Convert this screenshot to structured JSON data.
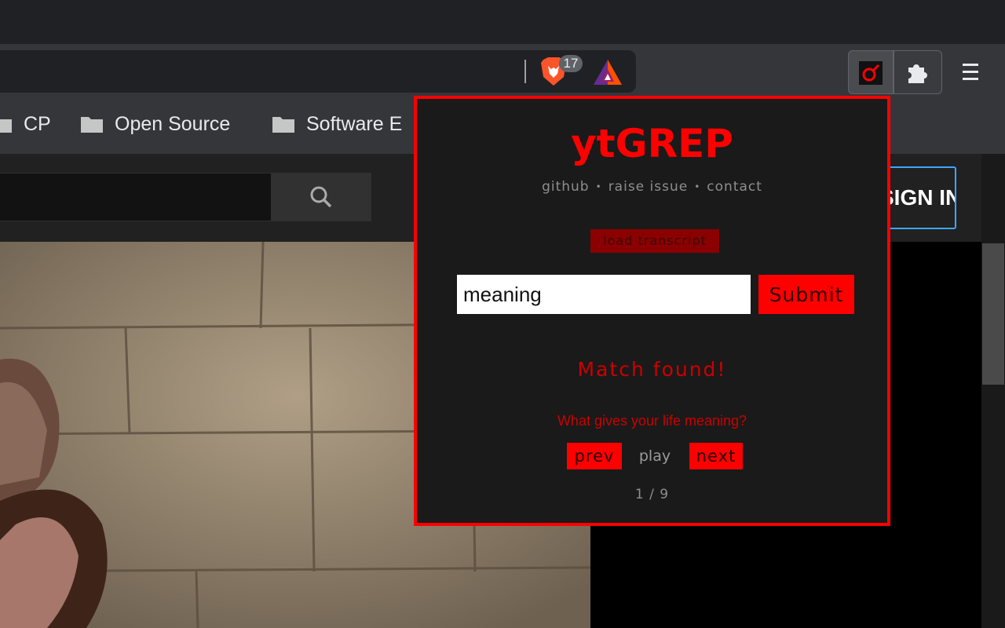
{
  "browser": {
    "shields_badge": "17",
    "menu_icon": "hamburger-icon",
    "bookmarks": [
      {
        "label": "CP"
      },
      {
        "label": "Open Source"
      },
      {
        "label": "Software E"
      }
    ]
  },
  "youtube": {
    "signin_label": "SIGN IN",
    "search_icon": "search-icon"
  },
  "popup": {
    "title": "ytGREP",
    "links": [
      "github",
      "raise issue",
      "contact"
    ],
    "load_label": "load transcript",
    "search_value": "meaning",
    "submit_label": "Submit",
    "status": "Match found!",
    "match_text": "What gives your life meaning?",
    "prev_label": "prev",
    "play_label": "play",
    "next_label": "next",
    "counter": "1 / 9",
    "accent_color": "#ff0000",
    "background_color": "#1a1a1a"
  }
}
